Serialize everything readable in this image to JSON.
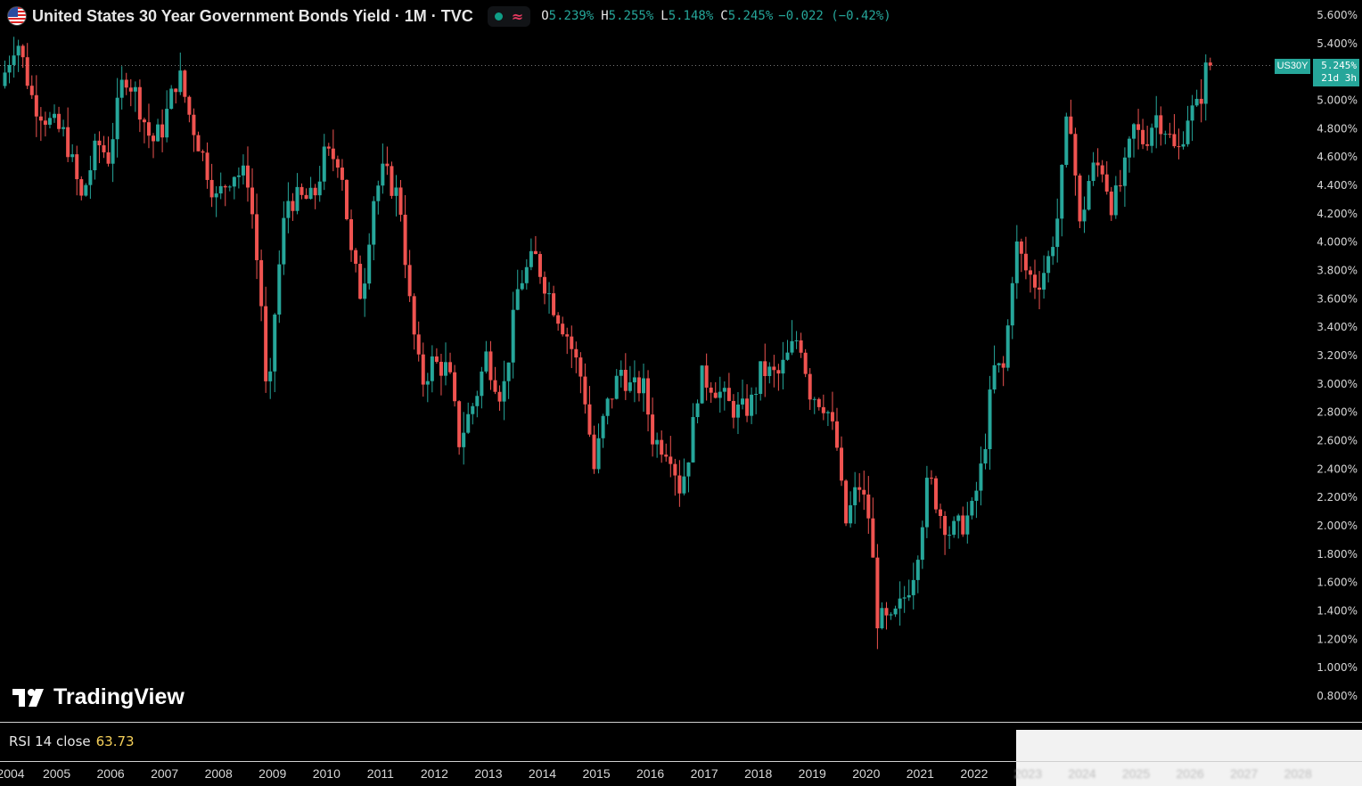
{
  "legend": {
    "title": "United States 30 Year Government Bonds Yield · 1M · TVC",
    "open_key": "O",
    "open": "5.239%",
    "high_key": "H",
    "high": "5.255%",
    "low_key": "L",
    "low": "5.148%",
    "close_key": "C",
    "close": "5.245%",
    "change": "−0.022 (−0.42%)"
  },
  "price_tag": {
    "symbol": "US30Y",
    "value": "5.245%",
    "countdown": "21d 3h"
  },
  "branding": {
    "logo_text": "TradingView"
  },
  "rsi": {
    "label": "RSI 14 close",
    "value": "63.73",
    "value_color": "#f5d05a"
  },
  "colors": {
    "up": "#26a69a",
    "down": "#ef5350",
    "background": "#000000",
    "axis_text": "#d6d6d6"
  },
  "chart_data": {
    "type": "candlestick",
    "title": "United States 30 Year Government Bonds Yield",
    "interval": "1M",
    "y_unit": "%",
    "ylim": [
      0.6,
      5.75
    ],
    "y_ticks": [
      "5.600%",
      "5.400%",
      "5.200%",
      "5.000%",
      "4.800%",
      "4.600%",
      "4.400%",
      "4.200%",
      "4.000%",
      "3.800%",
      "3.600%",
      "3.400%",
      "3.200%",
      "3.000%",
      "2.800%",
      "2.600%",
      "2.400%",
      "2.200%",
      "2.000%",
      "1.800%",
      "1.600%",
      "1.400%",
      "1.200%",
      "1.000%",
      "0.800%"
    ],
    "x_ticks": [
      "2004",
      "2005",
      "2006",
      "2007",
      "2008",
      "2009",
      "2010",
      "2011",
      "2012",
      "2013",
      "2014",
      "2015",
      "2016",
      "2017",
      "2018",
      "2019",
      "2020",
      "2021",
      "2022",
      "2023",
      "2024",
      "2025",
      "2026",
      "2027",
      "2028"
    ],
    "x_range": [
      2004.0,
      2028.4
    ],
    "last_price": 5.245,
    "anchors": [
      [
        2004.0,
        5.1
      ],
      [
        2004.3,
        5.45
      ],
      [
        2004.6,
        5.0
      ],
      [
        2004.9,
        4.85
      ],
      [
        2005.2,
        4.75
      ],
      [
        2005.5,
        4.3
      ],
      [
        2005.8,
        4.7
      ],
      [
        2006.0,
        4.6
      ],
      [
        2006.3,
        5.2
      ],
      [
        2006.5,
        5.05
      ],
      [
        2006.8,
        4.7
      ],
      [
        2007.0,
        4.8
      ],
      [
        2007.3,
        5.2
      ],
      [
        2007.5,
        4.9
      ],
      [
        2007.8,
        4.55
      ],
      [
        2008.0,
        4.3
      ],
      [
        2008.3,
        4.5
      ],
      [
        2008.6,
        4.45
      ],
      [
        2008.85,
        3.5
      ],
      [
        2008.95,
        2.7
      ],
      [
        2009.1,
        3.6
      ],
      [
        2009.3,
        4.3
      ],
      [
        2009.5,
        4.3
      ],
      [
        2009.8,
        4.3
      ],
      [
        2010.0,
        4.6
      ],
      [
        2010.3,
        4.6
      ],
      [
        2010.5,
        3.9
      ],
      [
        2010.7,
        3.6
      ],
      [
        2010.9,
        4.3
      ],
      [
        2011.1,
        4.5
      ],
      [
        2011.4,
        4.3
      ],
      [
        2011.6,
        3.5
      ],
      [
        2011.8,
        3.0
      ],
      [
        2012.0,
        3.15
      ],
      [
        2012.3,
        3.1
      ],
      [
        2012.5,
        2.6
      ],
      [
        2012.8,
        2.9
      ],
      [
        2013.0,
        3.2
      ],
      [
        2013.3,
        2.9
      ],
      [
        2013.6,
        3.7
      ],
      [
        2013.9,
        3.9
      ],
      [
        2014.2,
        3.6
      ],
      [
        2014.5,
        3.35
      ],
      [
        2014.8,
        3.0
      ],
      [
        2015.0,
        2.4
      ],
      [
        2015.2,
        2.8
      ],
      [
        2015.5,
        3.1
      ],
      [
        2015.7,
        2.95
      ],
      [
        2015.9,
        3.0
      ],
      [
        2016.1,
        2.6
      ],
      [
        2016.4,
        2.55
      ],
      [
        2016.6,
        2.25
      ],
      [
        2016.8,
        2.6
      ],
      [
        2016.95,
        3.05
      ],
      [
        2017.2,
        3.0
      ],
      [
        2017.5,
        2.85
      ],
      [
        2017.7,
        2.8
      ],
      [
        2017.9,
        2.85
      ],
      [
        2018.1,
        3.1
      ],
      [
        2018.4,
        3.05
      ],
      [
        2018.8,
        3.35
      ],
      [
        2019.0,
        2.95
      ],
      [
        2019.3,
        2.85
      ],
      [
        2019.5,
        2.55
      ],
      [
        2019.65,
        2.0
      ],
      [
        2019.9,
        2.3
      ],
      [
        2020.1,
        2.05
      ],
      [
        2020.25,
        1.35
      ],
      [
        2020.5,
        1.3
      ],
      [
        2020.7,
        1.45
      ],
      [
        2020.9,
        1.65
      ],
      [
        2021.0,
        1.85
      ],
      [
        2021.2,
        2.35
      ],
      [
        2021.4,
        2.1
      ],
      [
        2021.6,
        1.95
      ],
      [
        2021.8,
        2.0
      ],
      [
        2022.0,
        2.1
      ],
      [
        2022.2,
        2.45
      ],
      [
        2022.4,
        3.1
      ],
      [
        2022.6,
        3.1
      ],
      [
        2022.8,
        4.0
      ],
      [
        2023.0,
        3.8
      ],
      [
        2023.2,
        3.7
      ],
      [
        2023.4,
        3.85
      ],
      [
        2023.6,
        4.2
      ],
      [
        2023.8,
        5.0
      ],
      [
        2024.0,
        4.1
      ],
      [
        2024.2,
        4.5
      ],
      [
        2024.4,
        4.55
      ],
      [
        2024.6,
        4.25
      ],
      [
        2024.8,
        4.45
      ],
      [
        2025.0,
        4.8
      ],
      [
        2025.2,
        4.7
      ],
      [
        2025.4,
        4.9
      ],
      [
        2025.6,
        4.8
      ],
      [
        2025.8,
        4.6
      ],
      [
        2026.0,
        4.9
      ],
      [
        2026.2,
        4.95
      ],
      [
        2026.35,
        5.24
      ]
    ]
  }
}
